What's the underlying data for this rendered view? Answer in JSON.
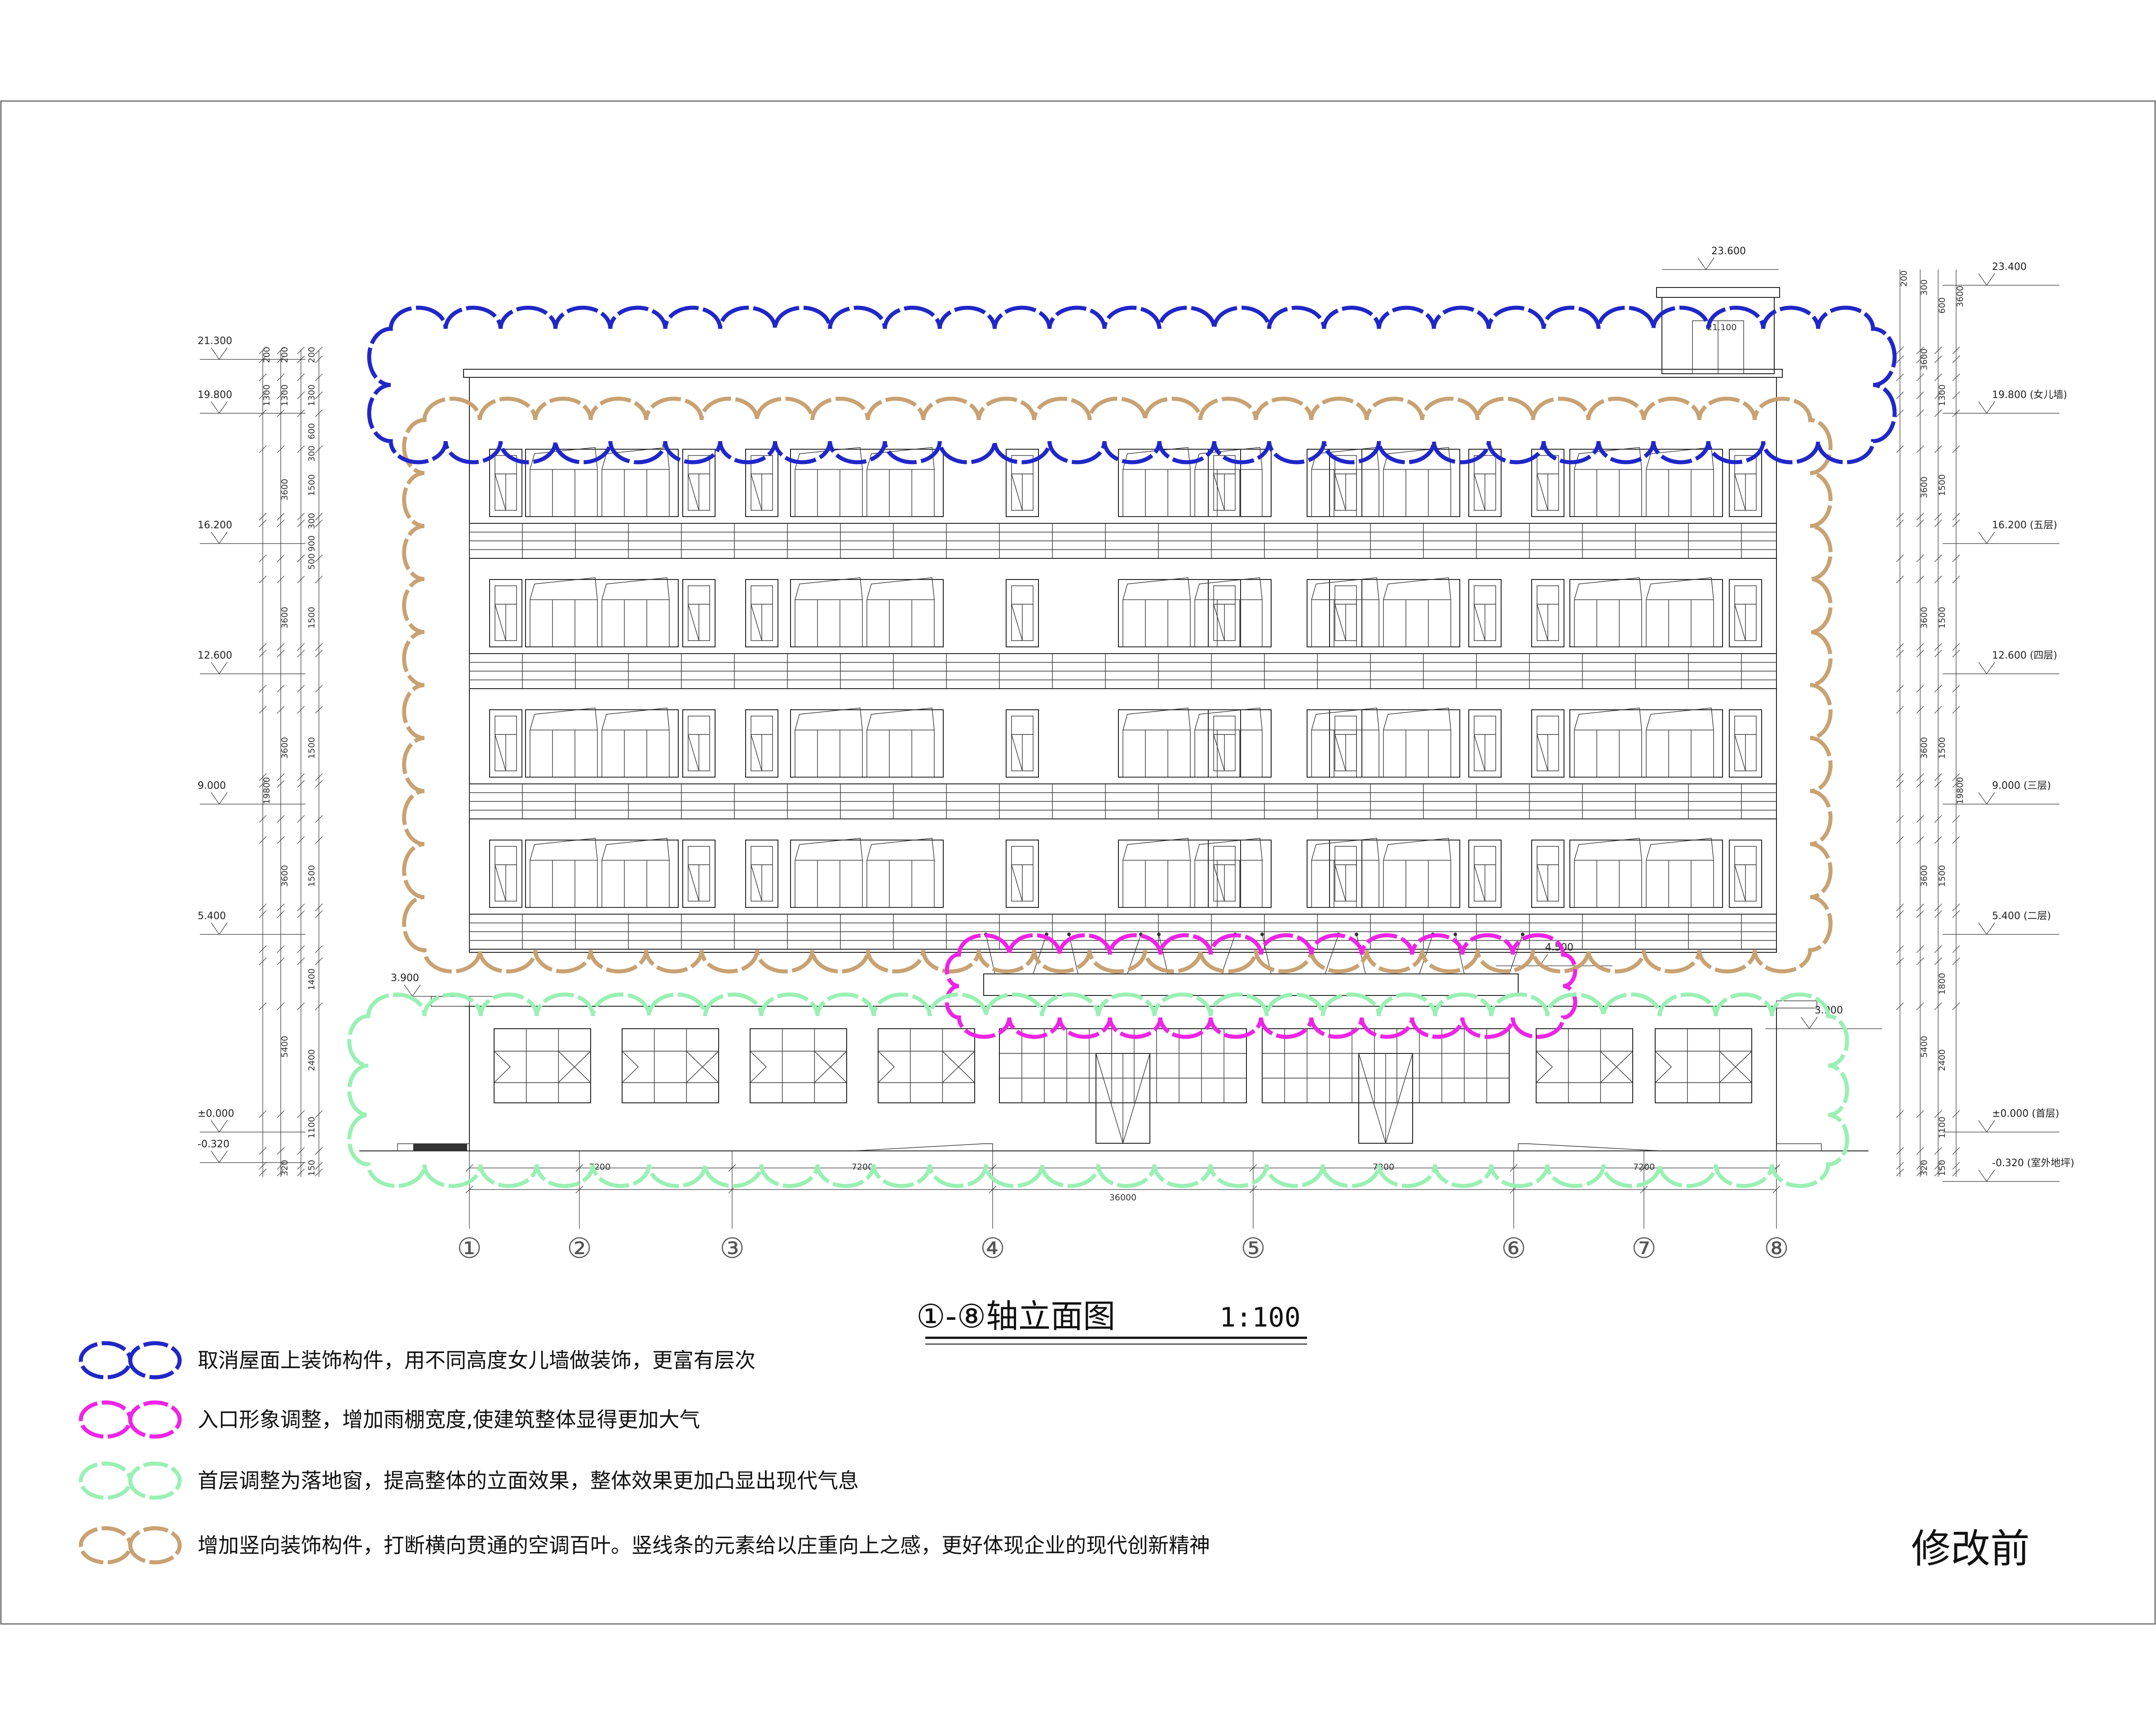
{
  "drawing": {
    "title": "①-⑧轴立面图",
    "scale": "1:100",
    "stage_label": "修改前"
  },
  "colors": {
    "blue": "#2027c8",
    "magenta": "#ee24e6",
    "green": "#9af0b4",
    "tan": "#c8a273"
  },
  "legend": [
    {
      "color": "#2027c8",
      "text": "取消屋面上装饰构件，用不同高度女儿墙做装饰，更富有层次"
    },
    {
      "color": "#ee24e6",
      "text": "入口形象调整，增加雨棚宽度,使建筑整体显得更加大气"
    },
    {
      "color": "#9af0b4",
      "text": "首层调整为落地窗，提高整体的立面效果，整体效果更加凸显出现代气息"
    },
    {
      "color": "#c8a273",
      "text": "增加竖向装饰构件，打断横向贯通的空调百叶。竖线条的元素给以庄重向上之感，更好体现企业的现代创新精神"
    }
  ],
  "axes": [
    "①",
    "②",
    "③",
    "④",
    "⑤",
    "⑥",
    "⑦",
    "⑧"
  ],
  "bay_dims": [
    "7200",
    "7200",
    "7200",
    "7200"
  ],
  "total_dim": "36000",
  "elevations_left": [
    "21.300",
    "19.800",
    "16.200",
    "12.600",
    "9.000",
    "5.400",
    "±0.000",
    "-0.320",
    "3.900"
  ],
  "elevations_right": [
    "23.400",
    "19.800 (女儿墙)",
    "16.200 (五层)",
    "12.600 (四层)",
    "9.000 (三层)",
    "5.400 (二层)",
    "±0.000 (首层)",
    "-0.320 (室外地坪)",
    "3.900",
    "23.600",
    "21.100",
    "4.500"
  ],
  "segment_dims": [
    "200",
    "1300",
    "300",
    "600",
    "3600",
    "1500",
    "900",
    "500",
    "19800",
    "5400",
    "1400",
    "2400",
    "1100",
    "320",
    "150",
    "1800"
  ]
}
